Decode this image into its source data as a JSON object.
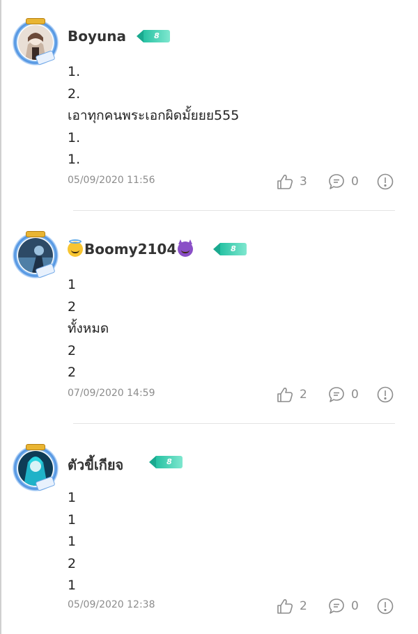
{
  "colors": {
    "level_badge": "#27c2a3",
    "avatar_ring": "#4a8fe0",
    "muted_text": "#8c8c8c",
    "divider": "#e4e4e4"
  },
  "comments": [
    {
      "username": "Boyuna",
      "level": "8",
      "lines": [
        "1.",
        "2.",
        "เอาทุกคนพระเอกผิดมั้ยยย555",
        "1.",
        "1."
      ],
      "timestamp": "05/09/2020 11:56",
      "likes": "3",
      "replies": "0",
      "icons": {
        "like": "thumbs-up-icon",
        "reply": "chat-bubble-icon",
        "report": "exclamation-icon"
      }
    },
    {
      "username": "Boomy2104",
      "username_prefix_emoji": "smiling-face-with-halo",
      "username_suffix_emoji": "smiling-face-with-horns",
      "level": "8",
      "lines": [
        "1",
        "2",
        "ทั้งหมด",
        "2",
        "2"
      ],
      "timestamp": "07/09/2020 14:59",
      "likes": "2",
      "replies": "0",
      "icons": {
        "like": "thumbs-up-icon",
        "reply": "chat-bubble-icon",
        "report": "exclamation-icon"
      }
    },
    {
      "username": "ตัวขี้เกียจ",
      "level": "8",
      "lines": [
        "1",
        "1",
        "1",
        "2",
        "1"
      ],
      "timestamp": "05/09/2020 12:38",
      "likes": "2",
      "replies": "0",
      "icons": {
        "like": "thumbs-up-icon",
        "reply": "chat-bubble-icon",
        "report": "exclamation-icon"
      }
    }
  ]
}
